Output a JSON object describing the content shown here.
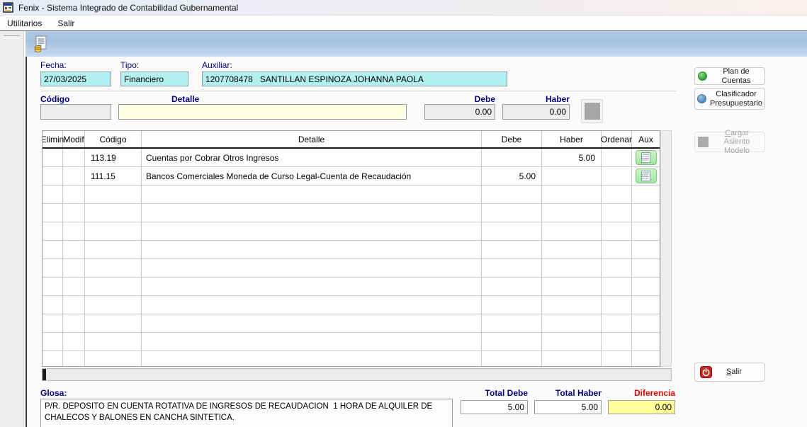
{
  "window": {
    "title": "Fenix - Sistema Integrado de Contabilidad Gubernamental",
    "menu": [
      {
        "label": "Utilitarios"
      },
      {
        "label": "Salir"
      }
    ]
  },
  "header_form": {
    "fecha_label": "Fecha:",
    "fecha_value": "27/03/2025",
    "tipo_label": "Tipo:",
    "tipo_value": "Financiero",
    "auxiliar_label": "Auxiliar:",
    "auxiliar_value": "1207708478   SANTILLAN ESPINOZA JOHANNA PAOLA"
  },
  "entry_row": {
    "codigo_label": "Código",
    "detalle_label": "Detalle",
    "debe_label": "Debe",
    "haber_label": "Haber",
    "codigo_value": "",
    "detalle_value": "",
    "debe_value": "0.00",
    "haber_value": "0.00"
  },
  "table": {
    "headers": [
      "Elimin",
      "Modif",
      "Código",
      "Detalle",
      "Debe",
      "Haber",
      "Ordenar",
      "Aux"
    ],
    "rows": [
      {
        "elimin": "",
        "modif": "",
        "codigo": "113.19",
        "detalle": "Cuentas por Cobrar Otros Ingresos",
        "debe": "",
        "haber": "5.00",
        "ordenar": ""
      },
      {
        "elimin": "",
        "modif": "",
        "codigo": "111.15",
        "detalle": "Bancos Comerciales Moneda de Curso Legal-Cuenta de Recaudación",
        "debe": "5.00",
        "haber": "",
        "ordenar": ""
      }
    ],
    "empty_row_count": 10
  },
  "side_buttons": {
    "plan_de_cuentas": "Plan de Cuentas",
    "clasificador_presupuestario": "Clasificador Presupuestario",
    "cargar_asiento_modelo": "Cargar Asiento Modelo",
    "salir": "Salir"
  },
  "footer": {
    "glosa_label": "Glosa:",
    "glosa_value": "P/R. DEPOSITO EN CUENTA ROTATIVA DE INGRESOS DE RECAUDACION  1 HORA DE ALQUILER DE CHALECOS Y BALONES EN CANCHA SINTETICA.",
    "total_debe_label": "Total Debe",
    "total_debe_value": "5.00",
    "total_haber_label": "Total Haber",
    "total_haber_value": "5.00",
    "diferencia_label": "Diferencia",
    "diferencia_value": "0.00"
  },
  "colors": {
    "label_navy": "#000080",
    "field_cyan": "#B2F0F0",
    "field_yellow": "#FFFFE1",
    "field_gray": "#EDEDED",
    "diferencia_yellow": "#FFFF9C",
    "diferencia_red": "#E00000",
    "aux_green_light": "#CFF5CB",
    "aux_green_dark": "#9FE89F"
  }
}
